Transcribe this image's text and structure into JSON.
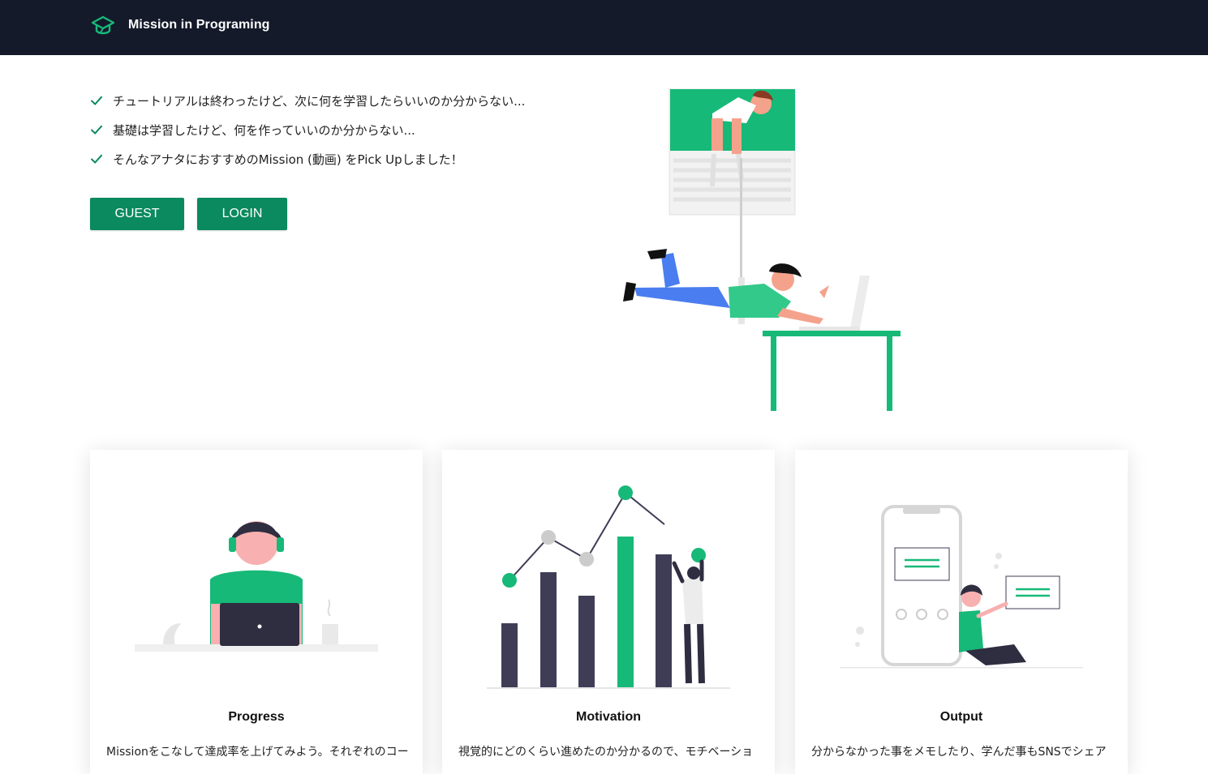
{
  "app": {
    "brand_name": "Mission in Programing",
    "logo_icon": "graduation-cap-icon"
  },
  "colors": {
    "navbar_bg": "#141a2a",
    "accent": "#0a8a5e",
    "illustration_green": "#17b978",
    "illustration_dark": "#3f3d56"
  },
  "hero": {
    "features": [
      {
        "icon": "check-icon",
        "text": "チュートリアルは終わったけど、次に何を学習したらいいのか分からない..."
      },
      {
        "icon": "check-icon",
        "text": "基礎は学習したけど、何を作っていいのか分からない..."
      },
      {
        "icon": "check-icon",
        "text": "そんなアナタにおすすめのMission (動画) をPick Upしました！"
      }
    ],
    "guest_button": "GUEST",
    "login_button": "LOGIN"
  },
  "cards": [
    {
      "title": "Progress",
      "text": "Missionをこなして達成率を上げてみよう。それぞれのコー",
      "illustration": "person-with-laptop-illustration"
    },
    {
      "title": "Motivation",
      "text": "視覚的にどのくらい進めたのか分かるので、モチベーショ",
      "illustration": "growth-chart-illustration"
    },
    {
      "title": "Output",
      "text": "分からなかった事をメモしたり、学んだ事もSNSでシェア",
      "illustration": "phone-share-illustration"
    }
  ]
}
